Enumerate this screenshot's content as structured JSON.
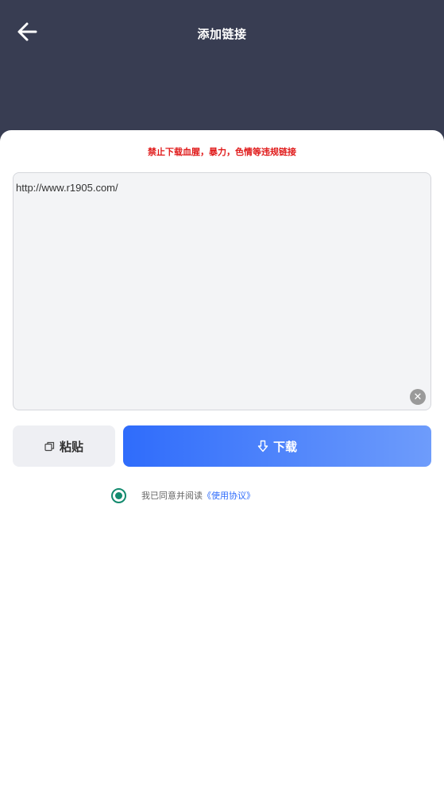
{
  "header": {
    "title": "添加链接",
    "back_icon": "arrow-left-icon"
  },
  "warning": "禁止下载血腥，暴力，色情等违规链接",
  "link_input": {
    "value": "http://www.r1905.com/"
  },
  "buttons": {
    "paste_label": "粘贴",
    "paste_icon": "copy-icon",
    "download_label": "下载",
    "download_icon": "download-arrow-icon"
  },
  "agreement": {
    "text": "我已同意并阅读",
    "link": "《使用协议》",
    "checked": true
  },
  "colors": {
    "header_bg": "#383d52",
    "warning": "#e01b1b",
    "accent": "#2f6cfb",
    "radio": "#138a6e"
  }
}
